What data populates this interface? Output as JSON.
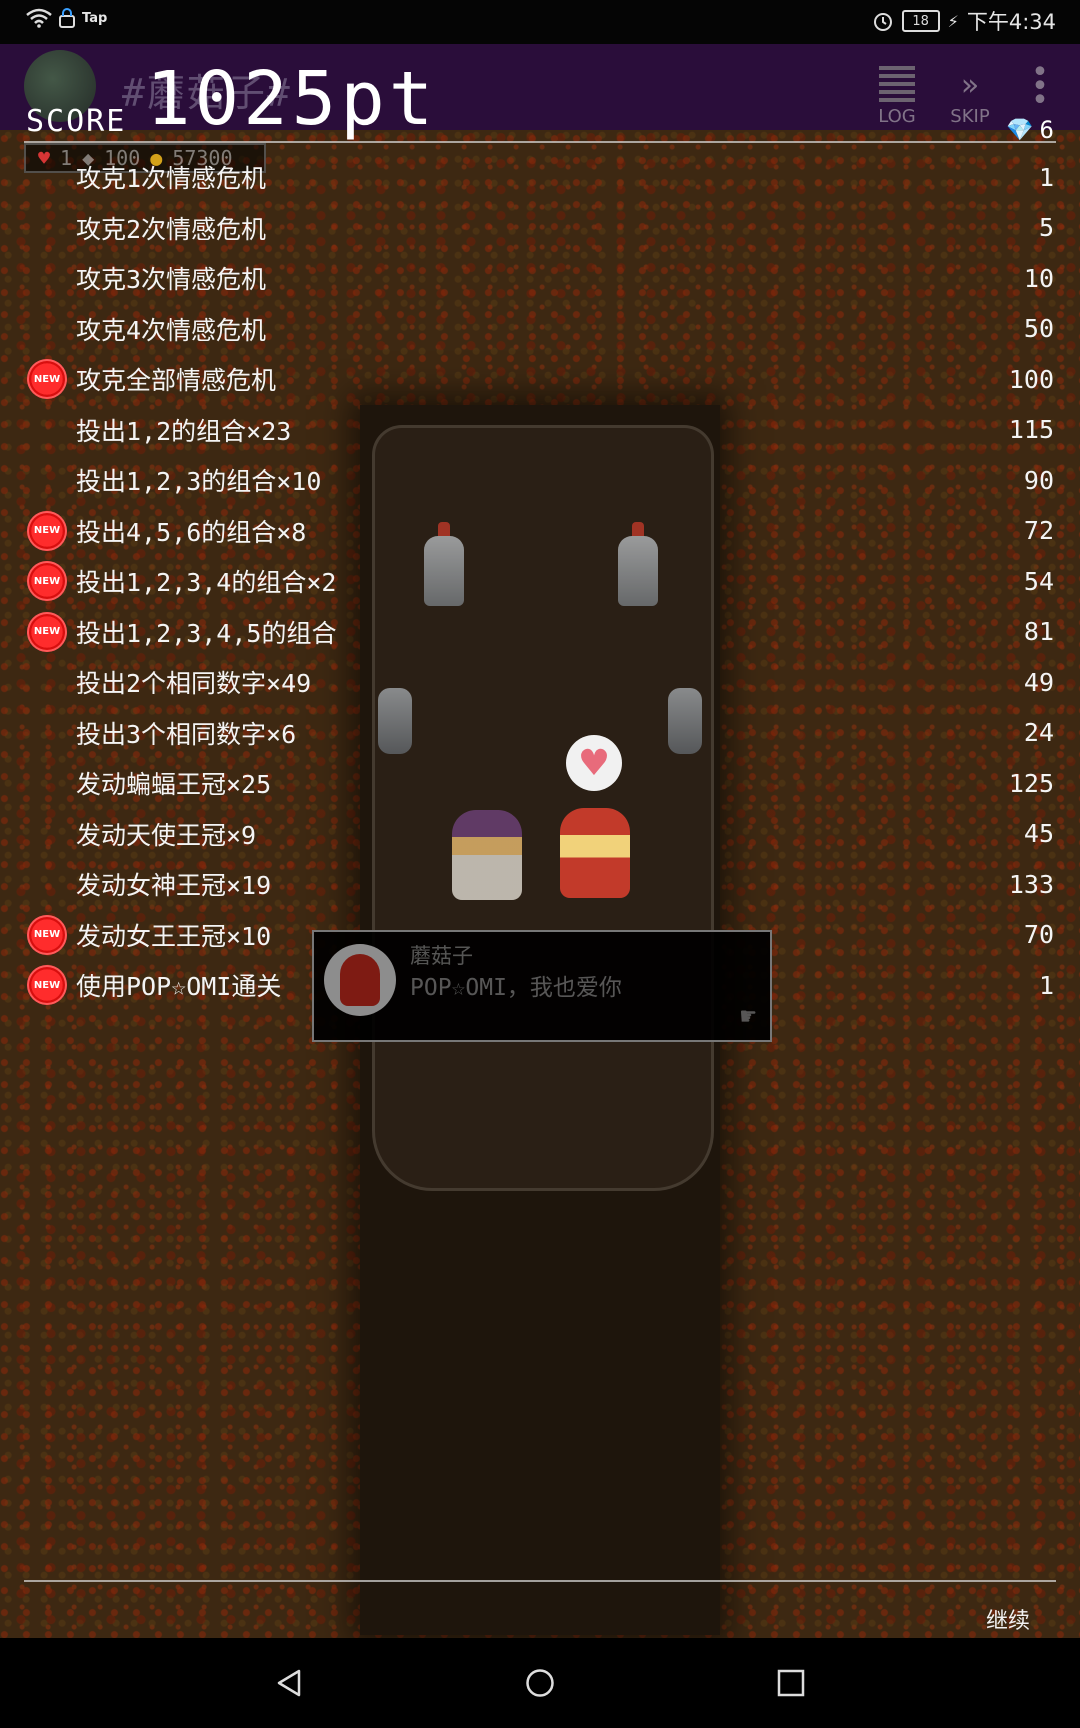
{
  "status_bar": {
    "left_app_label": "Tap",
    "battery_level": "18",
    "time": "下午4:34"
  },
  "header": {
    "title_ghost": "#蘑菇子#",
    "score_label": "SCORE",
    "score_value": "1025pt",
    "hud": {
      "hearts": "1",
      "cards": "100",
      "coins": "57300"
    },
    "log_label": "LOG",
    "skip_label": "SKIP",
    "gems": "6"
  },
  "score_rows": [
    {
      "label": "攻克1次情感危机",
      "value": "1",
      "is_new": false
    },
    {
      "label": "攻克2次情感危机",
      "value": "5",
      "is_new": false
    },
    {
      "label": "攻克3次情感危机",
      "value": "10",
      "is_new": false
    },
    {
      "label": "攻克4次情感危机",
      "value": "50",
      "is_new": false
    },
    {
      "label": "攻克全部情感危机",
      "value": "100",
      "is_new": true
    },
    {
      "label": "投出1,2的组合×23",
      "value": "115",
      "is_new": false
    },
    {
      "label": "投出1,2,3的组合×10",
      "value": "90",
      "is_new": false
    },
    {
      "label": "投出4,5,6的组合×8",
      "value": "72",
      "is_new": true
    },
    {
      "label": "投出1,2,3,4的组合×2",
      "value": "54",
      "is_new": true
    },
    {
      "label": "投出1,2,3,4,5的组合",
      "value": "81",
      "is_new": true
    },
    {
      "label": "投出2个相同数字×49",
      "value": "49",
      "is_new": false
    },
    {
      "label": "投出3个相同数字×6",
      "value": "24",
      "is_new": false
    },
    {
      "label": "发动蝙蝠王冠×25",
      "value": "125",
      "is_new": false
    },
    {
      "label": "发动天使王冠×9",
      "value": "45",
      "is_new": false
    },
    {
      "label": "发动女神王冠×19",
      "value": "133",
      "is_new": false
    },
    {
      "label": "发动女王王冠×10",
      "value": "70",
      "is_new": true
    },
    {
      "label": "使用POP☆OMI通关",
      "value": "1",
      "is_new": true
    }
  ],
  "new_badge_text": "NEW",
  "dialog": {
    "speaker": "蘑菇子",
    "text": "POP☆OMI，我也爱你"
  },
  "continue_label": "继续",
  "icons": {
    "heart": "heart-icon",
    "gem": "diamond-icon",
    "pointer": "hand-pointer-icon"
  },
  "colors": {
    "header_bg": "#2a0d3a",
    "new_badge": "#ff2c2c",
    "lava_bg": "#3d2812"
  }
}
